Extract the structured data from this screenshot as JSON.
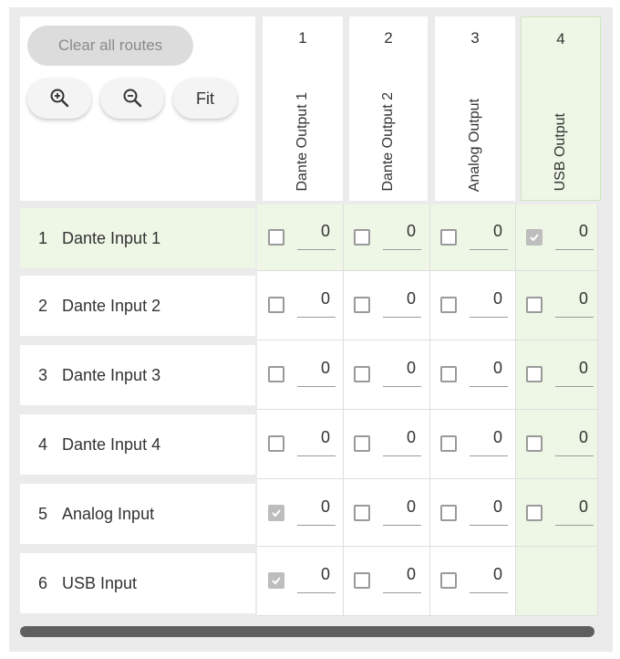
{
  "controls": {
    "clear_label": "Clear all routes",
    "zoom_in_icon": "zoom-in-icon",
    "zoom_out_icon": "zoom-out-icon",
    "fit_label": "Fit"
  },
  "columns": [
    {
      "num": "1",
      "name": "Dante Output 1",
      "highlighted": false
    },
    {
      "num": "2",
      "name": "Dante Output 2",
      "highlighted": false
    },
    {
      "num": "3",
      "name": "Analog Output",
      "highlighted": false
    },
    {
      "num": "4",
      "name": "USB Output",
      "highlighted": true
    }
  ],
  "rows": [
    {
      "num": "1",
      "name": "Dante Input 1",
      "highlighted": true
    },
    {
      "num": "2",
      "name": "Dante Input 2",
      "highlighted": false
    },
    {
      "num": "3",
      "name": "Dante Input 3",
      "highlighted": false
    },
    {
      "num": "4",
      "name": "Dante Input 4",
      "highlighted": false
    },
    {
      "num": "5",
      "name": "Analog Input",
      "highlighted": false
    },
    {
      "num": "6",
      "name": "USB Input",
      "highlighted": false
    }
  ],
  "cells": [
    [
      {
        "checked": false,
        "gain": "0"
      },
      {
        "checked": false,
        "gain": "0"
      },
      {
        "checked": false,
        "gain": "0"
      },
      {
        "checked": true,
        "gain": "0"
      }
    ],
    [
      {
        "checked": false,
        "gain": "0"
      },
      {
        "checked": false,
        "gain": "0"
      },
      {
        "checked": false,
        "gain": "0"
      },
      {
        "checked": false,
        "gain": "0"
      }
    ],
    [
      {
        "checked": false,
        "gain": "0"
      },
      {
        "checked": false,
        "gain": "0"
      },
      {
        "checked": false,
        "gain": "0"
      },
      {
        "checked": false,
        "gain": "0"
      }
    ],
    [
      {
        "checked": false,
        "gain": "0"
      },
      {
        "checked": false,
        "gain": "0"
      },
      {
        "checked": false,
        "gain": "0"
      },
      {
        "checked": false,
        "gain": "0"
      }
    ],
    [
      {
        "checked": true,
        "gain": "0"
      },
      {
        "checked": false,
        "gain": "0"
      },
      {
        "checked": false,
        "gain": "0"
      },
      {
        "checked": false,
        "gain": "0"
      }
    ],
    [
      {
        "checked": true,
        "gain": "0"
      },
      {
        "checked": false,
        "gain": "0"
      },
      {
        "checked": false,
        "gain": "0"
      },
      null
    ]
  ],
  "colors": {
    "highlight": "#eef7e6",
    "checked": "#bdbdbd",
    "scrollbar": "#5f5f5f"
  }
}
